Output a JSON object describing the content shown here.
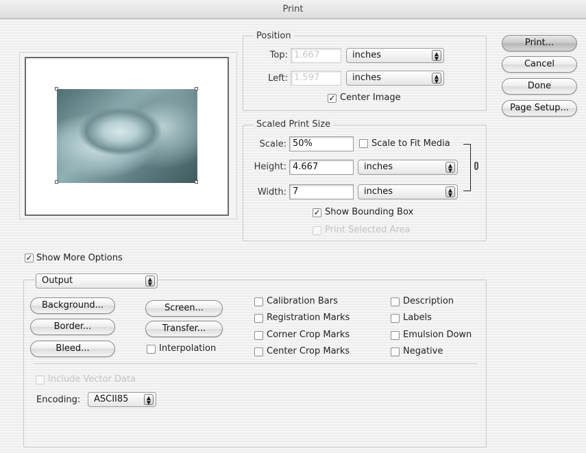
{
  "window": {
    "title": "Print"
  },
  "position": {
    "legend": "Position",
    "top_label": "Top:",
    "top_value": "1.667",
    "top_unit": "inches",
    "left_label": "Left:",
    "left_value": "1.597",
    "left_unit": "inches",
    "center_image_label": "Center Image",
    "center_image_checked": true
  },
  "scaled": {
    "legend": "Scaled Print Size",
    "scale_label": "Scale:",
    "scale_value": "50%",
    "scale_to_fit_label": "Scale to Fit Media",
    "height_label": "Height:",
    "height_value": "4.667",
    "height_unit": "inches",
    "width_label": "Width:",
    "width_value": "7",
    "width_unit": "inches",
    "show_bounding_box_label": "Show Bounding Box",
    "print_selected_area_label": "Print Selected Area"
  },
  "buttons": {
    "print": "Print...",
    "cancel": "Cancel",
    "done": "Done",
    "page_setup": "Page Setup..."
  },
  "more_options": {
    "label": "Show More Options",
    "dropdown_value": "Output"
  },
  "output": {
    "background": "Background...",
    "border": "Border...",
    "bleed": "Bleed...",
    "screen": "Screen...",
    "transfer": "Transfer...",
    "interpolation": "Interpolation",
    "calibration_bars": "Calibration Bars",
    "registration_marks": "Registration Marks",
    "corner_crop_marks": "Corner Crop Marks",
    "center_crop_marks": "Center Crop Marks",
    "description": "Description",
    "labels": "Labels",
    "emulsion_down": "Emulsion Down",
    "negative": "Negative",
    "include_vector_data": "Include Vector Data",
    "encoding_label": "Encoding:",
    "encoding_value": "ASCII85"
  },
  "checkmark": "✓"
}
